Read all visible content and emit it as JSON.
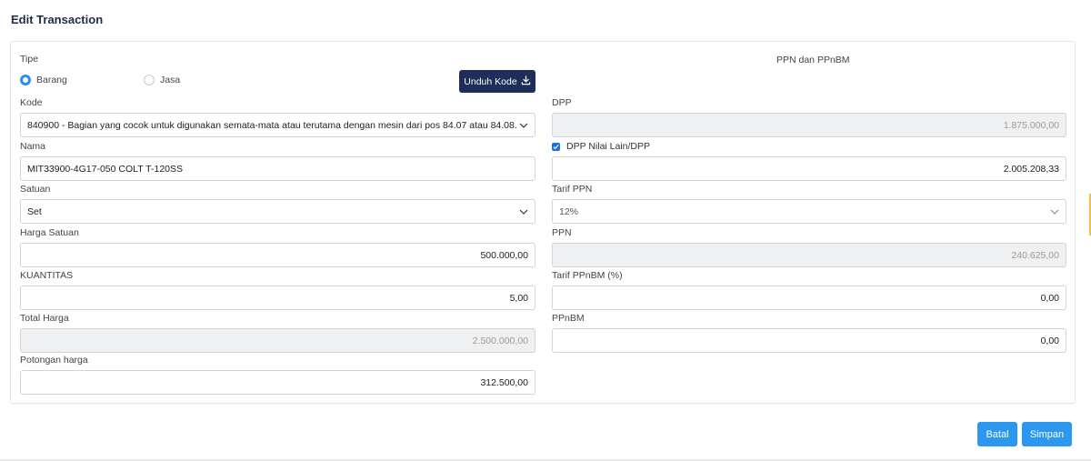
{
  "modal": {
    "title": "Edit Transaction"
  },
  "left": {
    "tipe_label": "Tipe",
    "radio_barang": "Barang",
    "radio_jasa": "Jasa",
    "unduh_kode": "Unduh Kode",
    "kode_label": "Kode",
    "kode_value": "840900 - Bagian yang cocok untuk digunakan semata-mata atau terutama dengan mesin dari pos 84.07 atau 84.08.",
    "nama_label": "Nama",
    "nama_value": "MIT33900-4G17-050 COLT T-120SS",
    "satuan_label": "Satuan",
    "satuan_value": "Set",
    "harga_label": "Harga Satuan",
    "harga_value": "500.000,00",
    "kuantitas_label": "KUANTITAS",
    "kuantitas_value": "5,00",
    "total_label": "Total Harga",
    "total_value": "2.500.000,00",
    "potongan_label": "Potongan harga",
    "potongan_value": "312.500,00"
  },
  "right": {
    "section_title": "PPN dan PPnBM",
    "dpp_label": "DPP",
    "dpp_value": "1.875.000,00",
    "dpp_lain_label": "DPP Nilai Lain/DPP",
    "dpp_lain_value": "2.005.208,33",
    "tarif_ppn_label": "Tarif PPN",
    "tarif_ppn_value": "12%",
    "ppn_label": "PPN",
    "ppn_value": "240.625,00",
    "tarif_ppnbm_label": "Tarif PPnBM (%)",
    "tarif_ppnbm_value": "0,00",
    "ppnbm_label": "PPnBM",
    "ppnbm_value": "0,00"
  },
  "footer": {
    "batal": "Batal",
    "simpan": "Simpan"
  },
  "colors": {
    "primary": "#2b97ef",
    "dark": "#1f2d5a",
    "title": "#1c2a48"
  }
}
